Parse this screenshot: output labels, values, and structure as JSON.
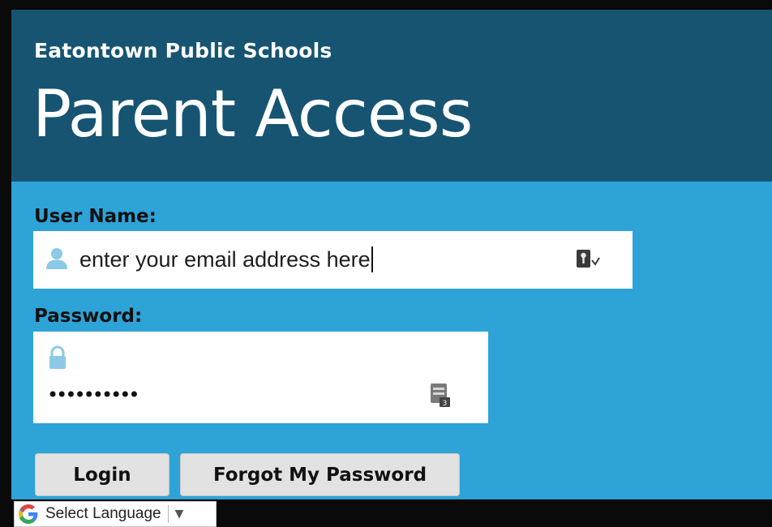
{
  "header": {
    "org_name": "Eatontown Public Schools",
    "title": "Parent Access"
  },
  "form": {
    "username_label": "User Name:",
    "username_value": "enter your email address here",
    "password_label": "Password:",
    "password_value": "••••••••••",
    "login_label": "Login",
    "forgot_label": "Forgot My Password"
  },
  "translate": {
    "label": "Select Language",
    "arrow": "▼"
  },
  "icons": {
    "user": "user-icon",
    "lock": "lock-icon",
    "key": "key-icon",
    "password_manager": "password-manager-icon",
    "google": "google-icon"
  },
  "colors": {
    "header_bg": "#165472",
    "content_bg": "#2ea3d8",
    "frame": "#0a0a0a",
    "button_bg": "#e2e2e2",
    "icon_tint": "#8cc9e6"
  }
}
